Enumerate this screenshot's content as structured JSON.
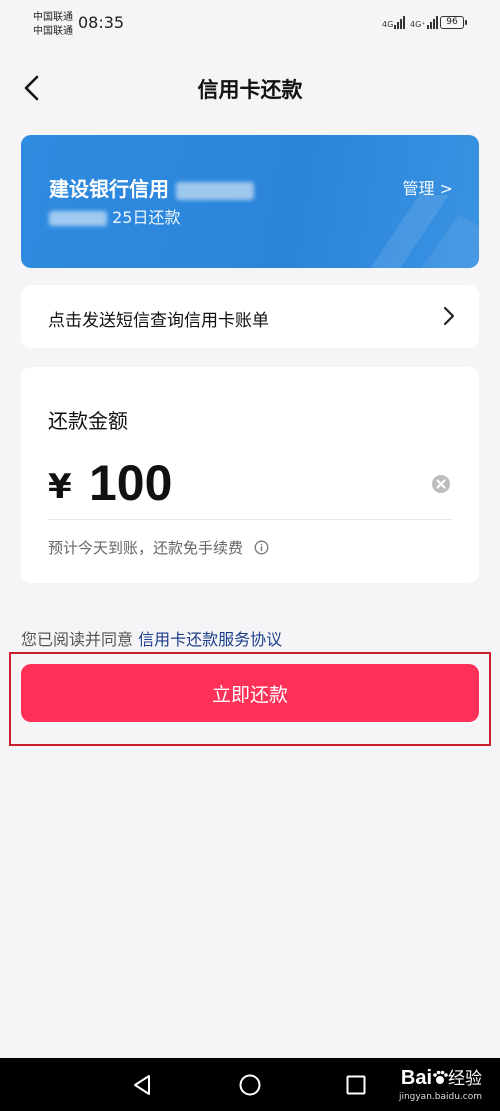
{
  "status_bar": {
    "carrier_1": "中国联通",
    "carrier_2": "中国联通",
    "time": "08:35",
    "network_1": "4G",
    "network_2": "4G⁺",
    "battery": "96"
  },
  "nav": {
    "title": "信用卡还款"
  },
  "card": {
    "bank_name": "建设银行信用",
    "due_text": "25日还款",
    "manage_label": "管理 >"
  },
  "sms_row": {
    "label": "点击发送短信查询信用卡账单"
  },
  "amount": {
    "title": "还款金额",
    "currency": "¥",
    "value": "100",
    "hint": "预计今天到账，还款免手续费"
  },
  "agreement": {
    "prefix": "您已阅读并同意",
    "link": "信用卡还款服务协议"
  },
  "pay_button": {
    "label": "立即还款"
  },
  "watermark": {
    "brand": "Bai",
    "brand_suffix": "经验",
    "url": "jingyan.baidu.com"
  },
  "colors": {
    "card_blue": "#2b84da",
    "pay_red": "#fd3058",
    "link_blue": "#1d3e8a",
    "highlight": "#c8202c"
  }
}
